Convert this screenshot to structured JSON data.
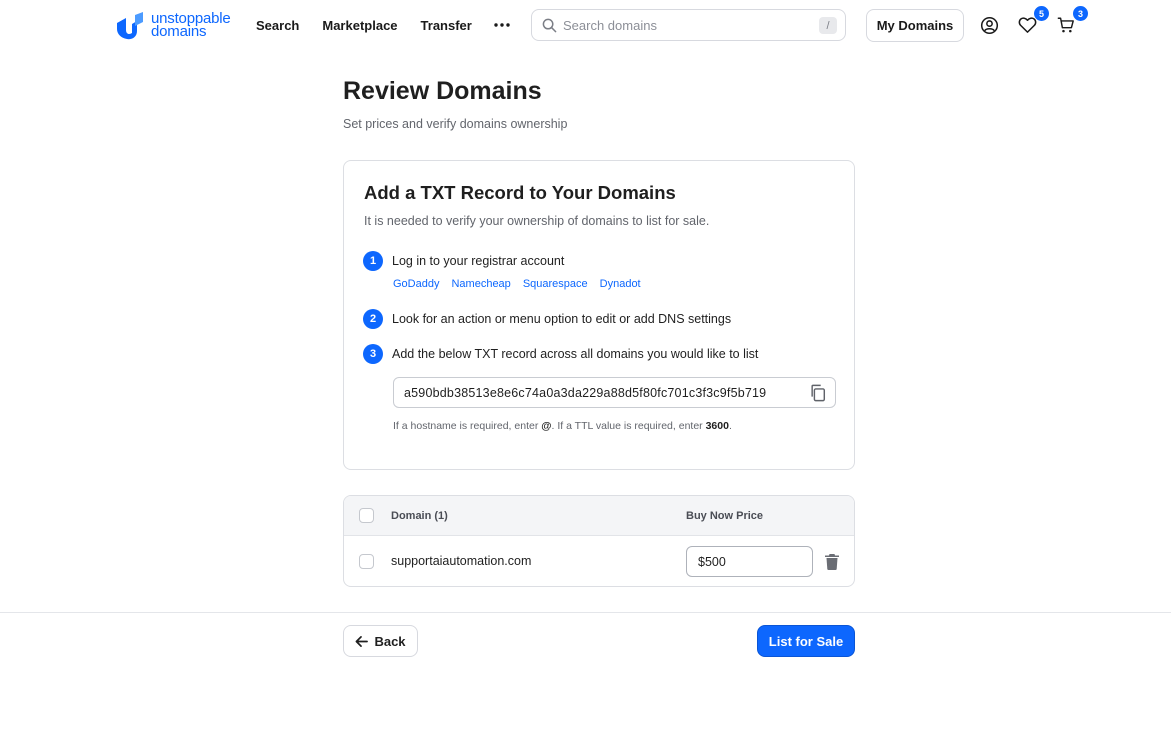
{
  "brand": {
    "line1": "unstoppable",
    "line2": "domains",
    "accent": "#0d67fe"
  },
  "nav": {
    "items": [
      "Search",
      "Marketplace",
      "Transfer"
    ],
    "more_icon": "more-horizontal-icon"
  },
  "search": {
    "placeholder": "Search domains",
    "shortcut": "/"
  },
  "header": {
    "my_domains_label": "My Domains",
    "favorites_count": "5",
    "cart_count": "3"
  },
  "page": {
    "title": "Review Domains",
    "subtitle": "Set prices and verify domains ownership"
  },
  "txt_card": {
    "title": "Add a TXT Record to Your Domains",
    "description": "It is needed to verify your ownership of domains to list for sale.",
    "steps": [
      {
        "num": "1",
        "text": "Log in to your registrar account"
      },
      {
        "num": "2",
        "text": "Look for an action or menu option to edit or add DNS settings"
      },
      {
        "num": "3",
        "text": "Add the below TXT record across all domains you would like to list"
      }
    ],
    "registrars": [
      "GoDaddy",
      "Namecheap",
      "Squarespace",
      "Dynadot"
    ],
    "txt_record": "a590bdb38513e8e6c74a0a3da229a88d5f80fc701c3f3c9f5b719",
    "hint_a": "If a hostname is required, enter ",
    "hint_host": "@",
    "hint_b": ". If a TTL value is required, enter ",
    "hint_ttl": "3600",
    "hint_c": "."
  },
  "table": {
    "col_domain": "Domain (1)",
    "col_price": "Buy Now Price",
    "rows": [
      {
        "domain": "supportaiautomation.com",
        "price": "$500"
      }
    ]
  },
  "footer": {
    "back_label": "Back",
    "list_label": "List for Sale"
  }
}
